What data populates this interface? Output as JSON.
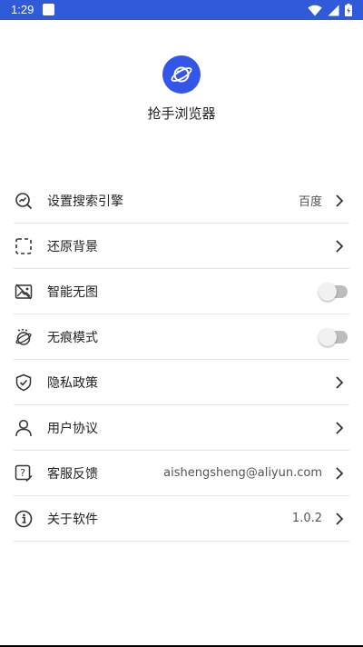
{
  "status_bar": {
    "time": "1:29"
  },
  "app": {
    "name": "抢手浏览器"
  },
  "menu": {
    "search_engine": {
      "label": "设置搜索引擎",
      "value": "百度"
    },
    "restore_background": {
      "label": "还原背景"
    },
    "smart_no_image": {
      "label": "智能无图",
      "enabled": false
    },
    "incognito_mode": {
      "label": "无痕模式",
      "enabled": false
    },
    "privacy_policy": {
      "label": "隐私政策"
    },
    "user_agreement": {
      "label": "用户协议"
    },
    "feedback": {
      "label": "客服反馈",
      "value": "aishengsheng@aliyun.com"
    },
    "about": {
      "label": "关于软件",
      "value": "1.0.2"
    }
  },
  "colors": {
    "accent": "#2f5bd9",
    "logo": "#3355e8",
    "toggle_off": "#bdbdbd"
  }
}
